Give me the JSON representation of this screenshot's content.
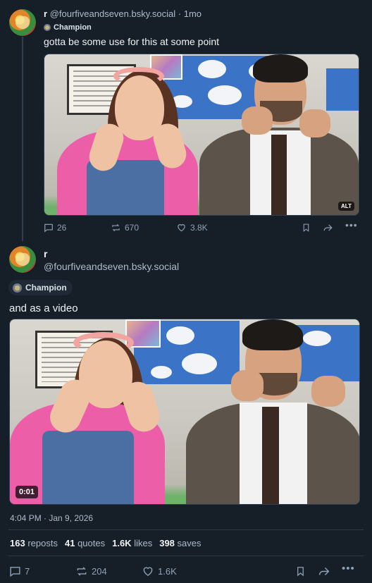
{
  "post1": {
    "author_name": "r",
    "handle": "@fourfiveandseven.bsky.social",
    "separator": "·",
    "age": "1mo",
    "badge": "Champion",
    "text": "gotta be some use for this at some point",
    "media_badge": "ALT",
    "actions": {
      "replies": "26",
      "reposts": "670",
      "likes": "3.8K"
    }
  },
  "post2": {
    "author_name": "r",
    "handle": "@fourfiveandseven.bsky.social",
    "badge": "Champion",
    "text": "and as a video",
    "video_time": "0:01",
    "timestamp": "4:04 PM · Jan 9, 2026",
    "stats": {
      "reposts_count": "163",
      "reposts_label": "reposts",
      "quotes_count": "41",
      "quotes_label": "quotes",
      "likes_count": "1.6K",
      "likes_label": "likes",
      "saves_count": "398",
      "saves_label": "saves"
    },
    "actions": {
      "replies": "7",
      "reposts": "204",
      "likes": "1.6K"
    }
  },
  "colors": {
    "background": "#161e27",
    "muted_text": "#8fa2b5",
    "accent": "#208bfe"
  },
  "icons": [
    "reply-icon",
    "repost-icon",
    "like-icon",
    "bookmark-icon",
    "share-icon",
    "more-icon"
  ]
}
